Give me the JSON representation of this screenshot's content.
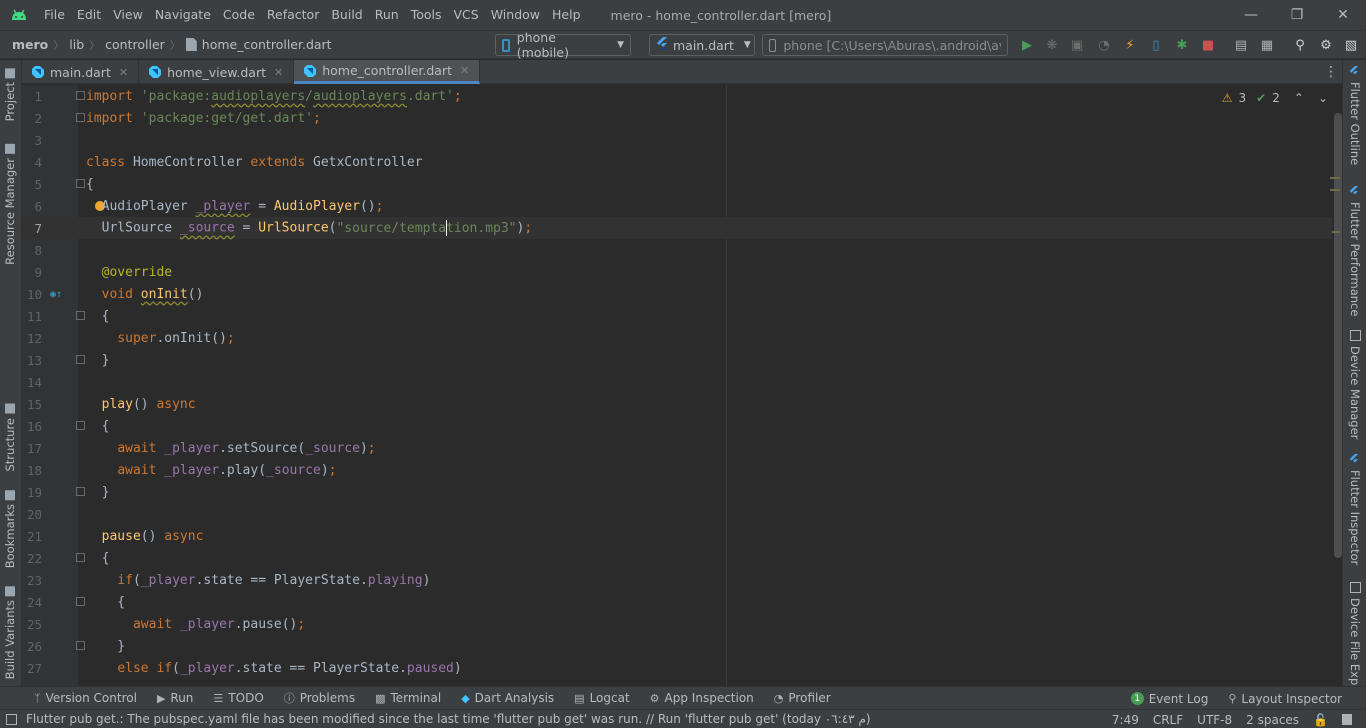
{
  "menubar": {
    "items": [
      "File",
      "Edit",
      "View",
      "Navigate",
      "Code",
      "Refactor",
      "Build",
      "Run",
      "Tools",
      "VCS",
      "Window",
      "Help"
    ],
    "title": "mero - home_controller.dart [mero]"
  },
  "navbar": {
    "breadcrumb": [
      "mero",
      "lib",
      "controller",
      "home_controller.dart"
    ],
    "device_selector": "phone (mobile)",
    "run_config": "main.dart",
    "device_path": "phone [C:\\Users\\Aburas\\.android\\avd\\p"
  },
  "tabs": [
    {
      "label": "main.dart",
      "active": false
    },
    {
      "label": "home_view.dart",
      "active": false
    },
    {
      "label": "home_controller.dart",
      "active": true
    }
  ],
  "left_tools": [
    "Project",
    "Resource Manager",
    "Structure",
    "Bookmarks",
    "Build Variants"
  ],
  "right_tools": [
    "Flutter Outline",
    "Flutter Performance",
    "Device Manager",
    "Flutter Inspector",
    "Device File Explorer"
  ],
  "inspections": {
    "warnings": "3",
    "weak_warnings": "2"
  },
  "editor": {
    "current_line": 7,
    "lines": [
      {
        "n": "1",
        "text": "import 'package:audioplayers/audioplayers.dart';"
      },
      {
        "n": "2",
        "text": "import 'package:get/get.dart';"
      },
      {
        "n": "3",
        "text": ""
      },
      {
        "n": "4",
        "text": "class HomeController extends GetxController"
      },
      {
        "n": "5",
        "text": "{"
      },
      {
        "n": "6",
        "text": "  AudioPlayer _player = AudioPlayer();"
      },
      {
        "n": "7",
        "text": "  UrlSource _source = UrlSource(\"source/temptation.mp3\");"
      },
      {
        "n": "8",
        "text": ""
      },
      {
        "n": "9",
        "text": "  @override"
      },
      {
        "n": "10",
        "text": "  void onInit()"
      },
      {
        "n": "11",
        "text": "  {"
      },
      {
        "n": "12",
        "text": "    super.onInit();"
      },
      {
        "n": "13",
        "text": "  }"
      },
      {
        "n": "14",
        "text": ""
      },
      {
        "n": "15",
        "text": "  play() async"
      },
      {
        "n": "16",
        "text": "  {"
      },
      {
        "n": "17",
        "text": "    await _player.setSource(_source);"
      },
      {
        "n": "18",
        "text": "    await _player.play(_source);"
      },
      {
        "n": "19",
        "text": "  }"
      },
      {
        "n": "20",
        "text": ""
      },
      {
        "n": "21",
        "text": "  pause() async"
      },
      {
        "n": "22",
        "text": "  {"
      },
      {
        "n": "23",
        "text": "    if(_player.state == PlayerState.playing)"
      },
      {
        "n": "24",
        "text": "    {"
      },
      {
        "n": "25",
        "text": "      await _player.pause();"
      },
      {
        "n": "26",
        "text": "    }"
      },
      {
        "n": "27",
        "text": "    else if(_player.state == PlayerState.paused)"
      }
    ]
  },
  "bottom_tools": [
    "Version Control",
    "Run",
    "TODO",
    "Problems",
    "Terminal",
    "Dart Analysis",
    "Logcat",
    "App Inspection",
    "Profiler"
  ],
  "bottom_right_tools": {
    "event_log_count": "1",
    "event_log": "Event Log",
    "layout_inspector": "Layout Inspector"
  },
  "statusbar": {
    "message": "Flutter pub get.: The pubspec.yaml file has been modified since the last time 'flutter pub get' was run. // Run 'flutter pub get' (today م ٠٦:٤٣)",
    "position": "7:49",
    "line_sep": "CRLF",
    "encoding": "UTF-8",
    "indent": "2 spaces"
  },
  "colors": {
    "accent": "#4a88c7",
    "run_green": "#499c54",
    "stop_red": "#c75450",
    "bolt_yellow": "#f0a732"
  }
}
